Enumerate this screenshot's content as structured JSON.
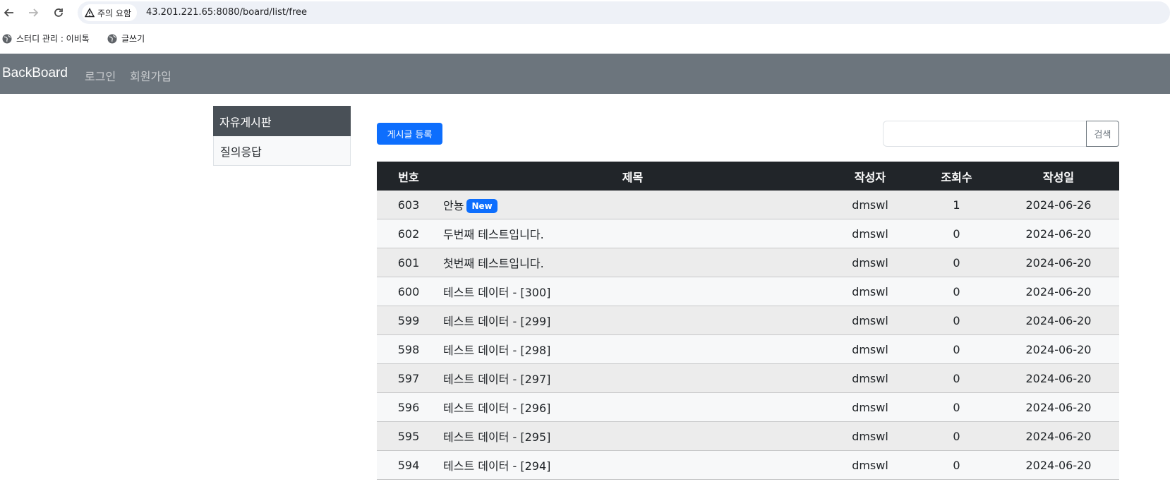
{
  "browser": {
    "warning_label": "주의 요함",
    "url": "43.201.221.65:8080/board/list/free",
    "bookmarks": [
      "스터디 관리 : 이비톡",
      "글쓰기"
    ]
  },
  "navbar": {
    "brand": "BackBoard",
    "links": [
      "로그인",
      "회원가입"
    ]
  },
  "sidebar": {
    "items": [
      {
        "label": "자유게시판",
        "active": true
      },
      {
        "label": "질의응답",
        "active": false
      }
    ]
  },
  "toolbar": {
    "create_button": "게시글 등록",
    "search_placeholder": "",
    "search_button": "검색"
  },
  "table": {
    "headers": [
      "번호",
      "제목",
      "작성자",
      "조회수",
      "작성일"
    ],
    "new_badge": "New",
    "rows": [
      {
        "no": "603",
        "title": "안뇽",
        "author": "dmswl",
        "views": "1",
        "date": "2024-06-26",
        "is_new": true
      },
      {
        "no": "602",
        "title": "두번째 테스트입니다.",
        "author": "dmswl",
        "views": "0",
        "date": "2024-06-20"
      },
      {
        "no": "601",
        "title": "첫번째 테스트입니다.",
        "author": "dmswl",
        "views": "0",
        "date": "2024-06-20"
      },
      {
        "no": "600",
        "title": "테스트 데이터 - [300]",
        "author": "dmswl",
        "views": "0",
        "date": "2024-06-20"
      },
      {
        "no": "599",
        "title": "테스트 데이터 - [299]",
        "author": "dmswl",
        "views": "0",
        "date": "2024-06-20"
      },
      {
        "no": "598",
        "title": "테스트 데이터 - [298]",
        "author": "dmswl",
        "views": "0",
        "date": "2024-06-20"
      },
      {
        "no": "597",
        "title": "테스트 데이터 - [297]",
        "author": "dmswl",
        "views": "0",
        "date": "2024-06-20"
      },
      {
        "no": "596",
        "title": "테스트 데이터 - [296]",
        "author": "dmswl",
        "views": "0",
        "date": "2024-06-20"
      },
      {
        "no": "595",
        "title": "테스트 데이터 - [295]",
        "author": "dmswl",
        "views": "0",
        "date": "2024-06-20"
      },
      {
        "no": "594",
        "title": "테스트 데이터 - [294]",
        "author": "dmswl",
        "views": "0",
        "date": "2024-06-20"
      }
    ]
  }
}
